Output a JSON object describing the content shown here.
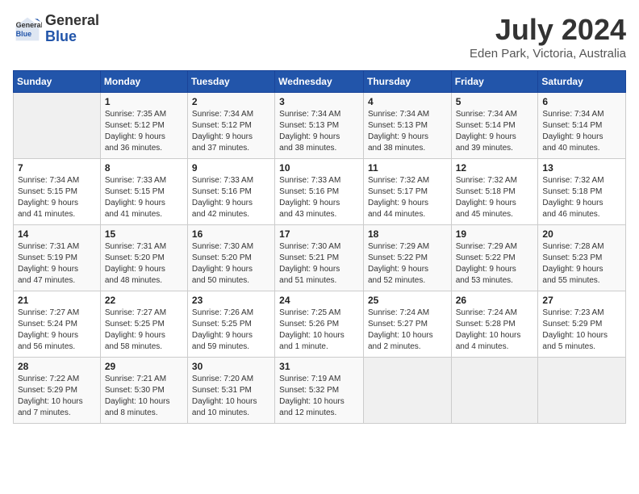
{
  "header": {
    "logo_general": "General",
    "logo_blue": "Blue",
    "title": "July 2024",
    "subtitle": "Eden Park, Victoria, Australia"
  },
  "columns": [
    "Sunday",
    "Monday",
    "Tuesday",
    "Wednesday",
    "Thursday",
    "Friday",
    "Saturday"
  ],
  "weeks": [
    [
      {
        "day": "",
        "info": ""
      },
      {
        "day": "1",
        "info": "Sunrise: 7:35 AM\nSunset: 5:12 PM\nDaylight: 9 hours\nand 36 minutes."
      },
      {
        "day": "2",
        "info": "Sunrise: 7:34 AM\nSunset: 5:12 PM\nDaylight: 9 hours\nand 37 minutes."
      },
      {
        "day": "3",
        "info": "Sunrise: 7:34 AM\nSunset: 5:13 PM\nDaylight: 9 hours\nand 38 minutes."
      },
      {
        "day": "4",
        "info": "Sunrise: 7:34 AM\nSunset: 5:13 PM\nDaylight: 9 hours\nand 38 minutes."
      },
      {
        "day": "5",
        "info": "Sunrise: 7:34 AM\nSunset: 5:14 PM\nDaylight: 9 hours\nand 39 minutes."
      },
      {
        "day": "6",
        "info": "Sunrise: 7:34 AM\nSunset: 5:14 PM\nDaylight: 9 hours\nand 40 minutes."
      }
    ],
    [
      {
        "day": "7",
        "info": "Sunrise: 7:34 AM\nSunset: 5:15 PM\nDaylight: 9 hours\nand 41 minutes."
      },
      {
        "day": "8",
        "info": "Sunrise: 7:33 AM\nSunset: 5:15 PM\nDaylight: 9 hours\nand 41 minutes."
      },
      {
        "day": "9",
        "info": "Sunrise: 7:33 AM\nSunset: 5:16 PM\nDaylight: 9 hours\nand 42 minutes."
      },
      {
        "day": "10",
        "info": "Sunrise: 7:33 AM\nSunset: 5:16 PM\nDaylight: 9 hours\nand 43 minutes."
      },
      {
        "day": "11",
        "info": "Sunrise: 7:32 AM\nSunset: 5:17 PM\nDaylight: 9 hours\nand 44 minutes."
      },
      {
        "day": "12",
        "info": "Sunrise: 7:32 AM\nSunset: 5:18 PM\nDaylight: 9 hours\nand 45 minutes."
      },
      {
        "day": "13",
        "info": "Sunrise: 7:32 AM\nSunset: 5:18 PM\nDaylight: 9 hours\nand 46 minutes."
      }
    ],
    [
      {
        "day": "14",
        "info": "Sunrise: 7:31 AM\nSunset: 5:19 PM\nDaylight: 9 hours\nand 47 minutes."
      },
      {
        "day": "15",
        "info": "Sunrise: 7:31 AM\nSunset: 5:20 PM\nDaylight: 9 hours\nand 48 minutes."
      },
      {
        "day": "16",
        "info": "Sunrise: 7:30 AM\nSunset: 5:20 PM\nDaylight: 9 hours\nand 50 minutes."
      },
      {
        "day": "17",
        "info": "Sunrise: 7:30 AM\nSunset: 5:21 PM\nDaylight: 9 hours\nand 51 minutes."
      },
      {
        "day": "18",
        "info": "Sunrise: 7:29 AM\nSunset: 5:22 PM\nDaylight: 9 hours\nand 52 minutes."
      },
      {
        "day": "19",
        "info": "Sunrise: 7:29 AM\nSunset: 5:22 PM\nDaylight: 9 hours\nand 53 minutes."
      },
      {
        "day": "20",
        "info": "Sunrise: 7:28 AM\nSunset: 5:23 PM\nDaylight: 9 hours\nand 55 minutes."
      }
    ],
    [
      {
        "day": "21",
        "info": "Sunrise: 7:27 AM\nSunset: 5:24 PM\nDaylight: 9 hours\nand 56 minutes."
      },
      {
        "day": "22",
        "info": "Sunrise: 7:27 AM\nSunset: 5:25 PM\nDaylight: 9 hours\nand 58 minutes."
      },
      {
        "day": "23",
        "info": "Sunrise: 7:26 AM\nSunset: 5:25 PM\nDaylight: 9 hours\nand 59 minutes."
      },
      {
        "day": "24",
        "info": "Sunrise: 7:25 AM\nSunset: 5:26 PM\nDaylight: 10 hours\nand 1 minute."
      },
      {
        "day": "25",
        "info": "Sunrise: 7:24 AM\nSunset: 5:27 PM\nDaylight: 10 hours\nand 2 minutes."
      },
      {
        "day": "26",
        "info": "Sunrise: 7:24 AM\nSunset: 5:28 PM\nDaylight: 10 hours\nand 4 minutes."
      },
      {
        "day": "27",
        "info": "Sunrise: 7:23 AM\nSunset: 5:29 PM\nDaylight: 10 hours\nand 5 minutes."
      }
    ],
    [
      {
        "day": "28",
        "info": "Sunrise: 7:22 AM\nSunset: 5:29 PM\nDaylight: 10 hours\nand 7 minutes."
      },
      {
        "day": "29",
        "info": "Sunrise: 7:21 AM\nSunset: 5:30 PM\nDaylight: 10 hours\nand 8 minutes."
      },
      {
        "day": "30",
        "info": "Sunrise: 7:20 AM\nSunset: 5:31 PM\nDaylight: 10 hours\nand 10 minutes."
      },
      {
        "day": "31",
        "info": "Sunrise: 7:19 AM\nSunset: 5:32 PM\nDaylight: 10 hours\nand 12 minutes."
      },
      {
        "day": "",
        "info": ""
      },
      {
        "day": "",
        "info": ""
      },
      {
        "day": "",
        "info": ""
      }
    ]
  ]
}
